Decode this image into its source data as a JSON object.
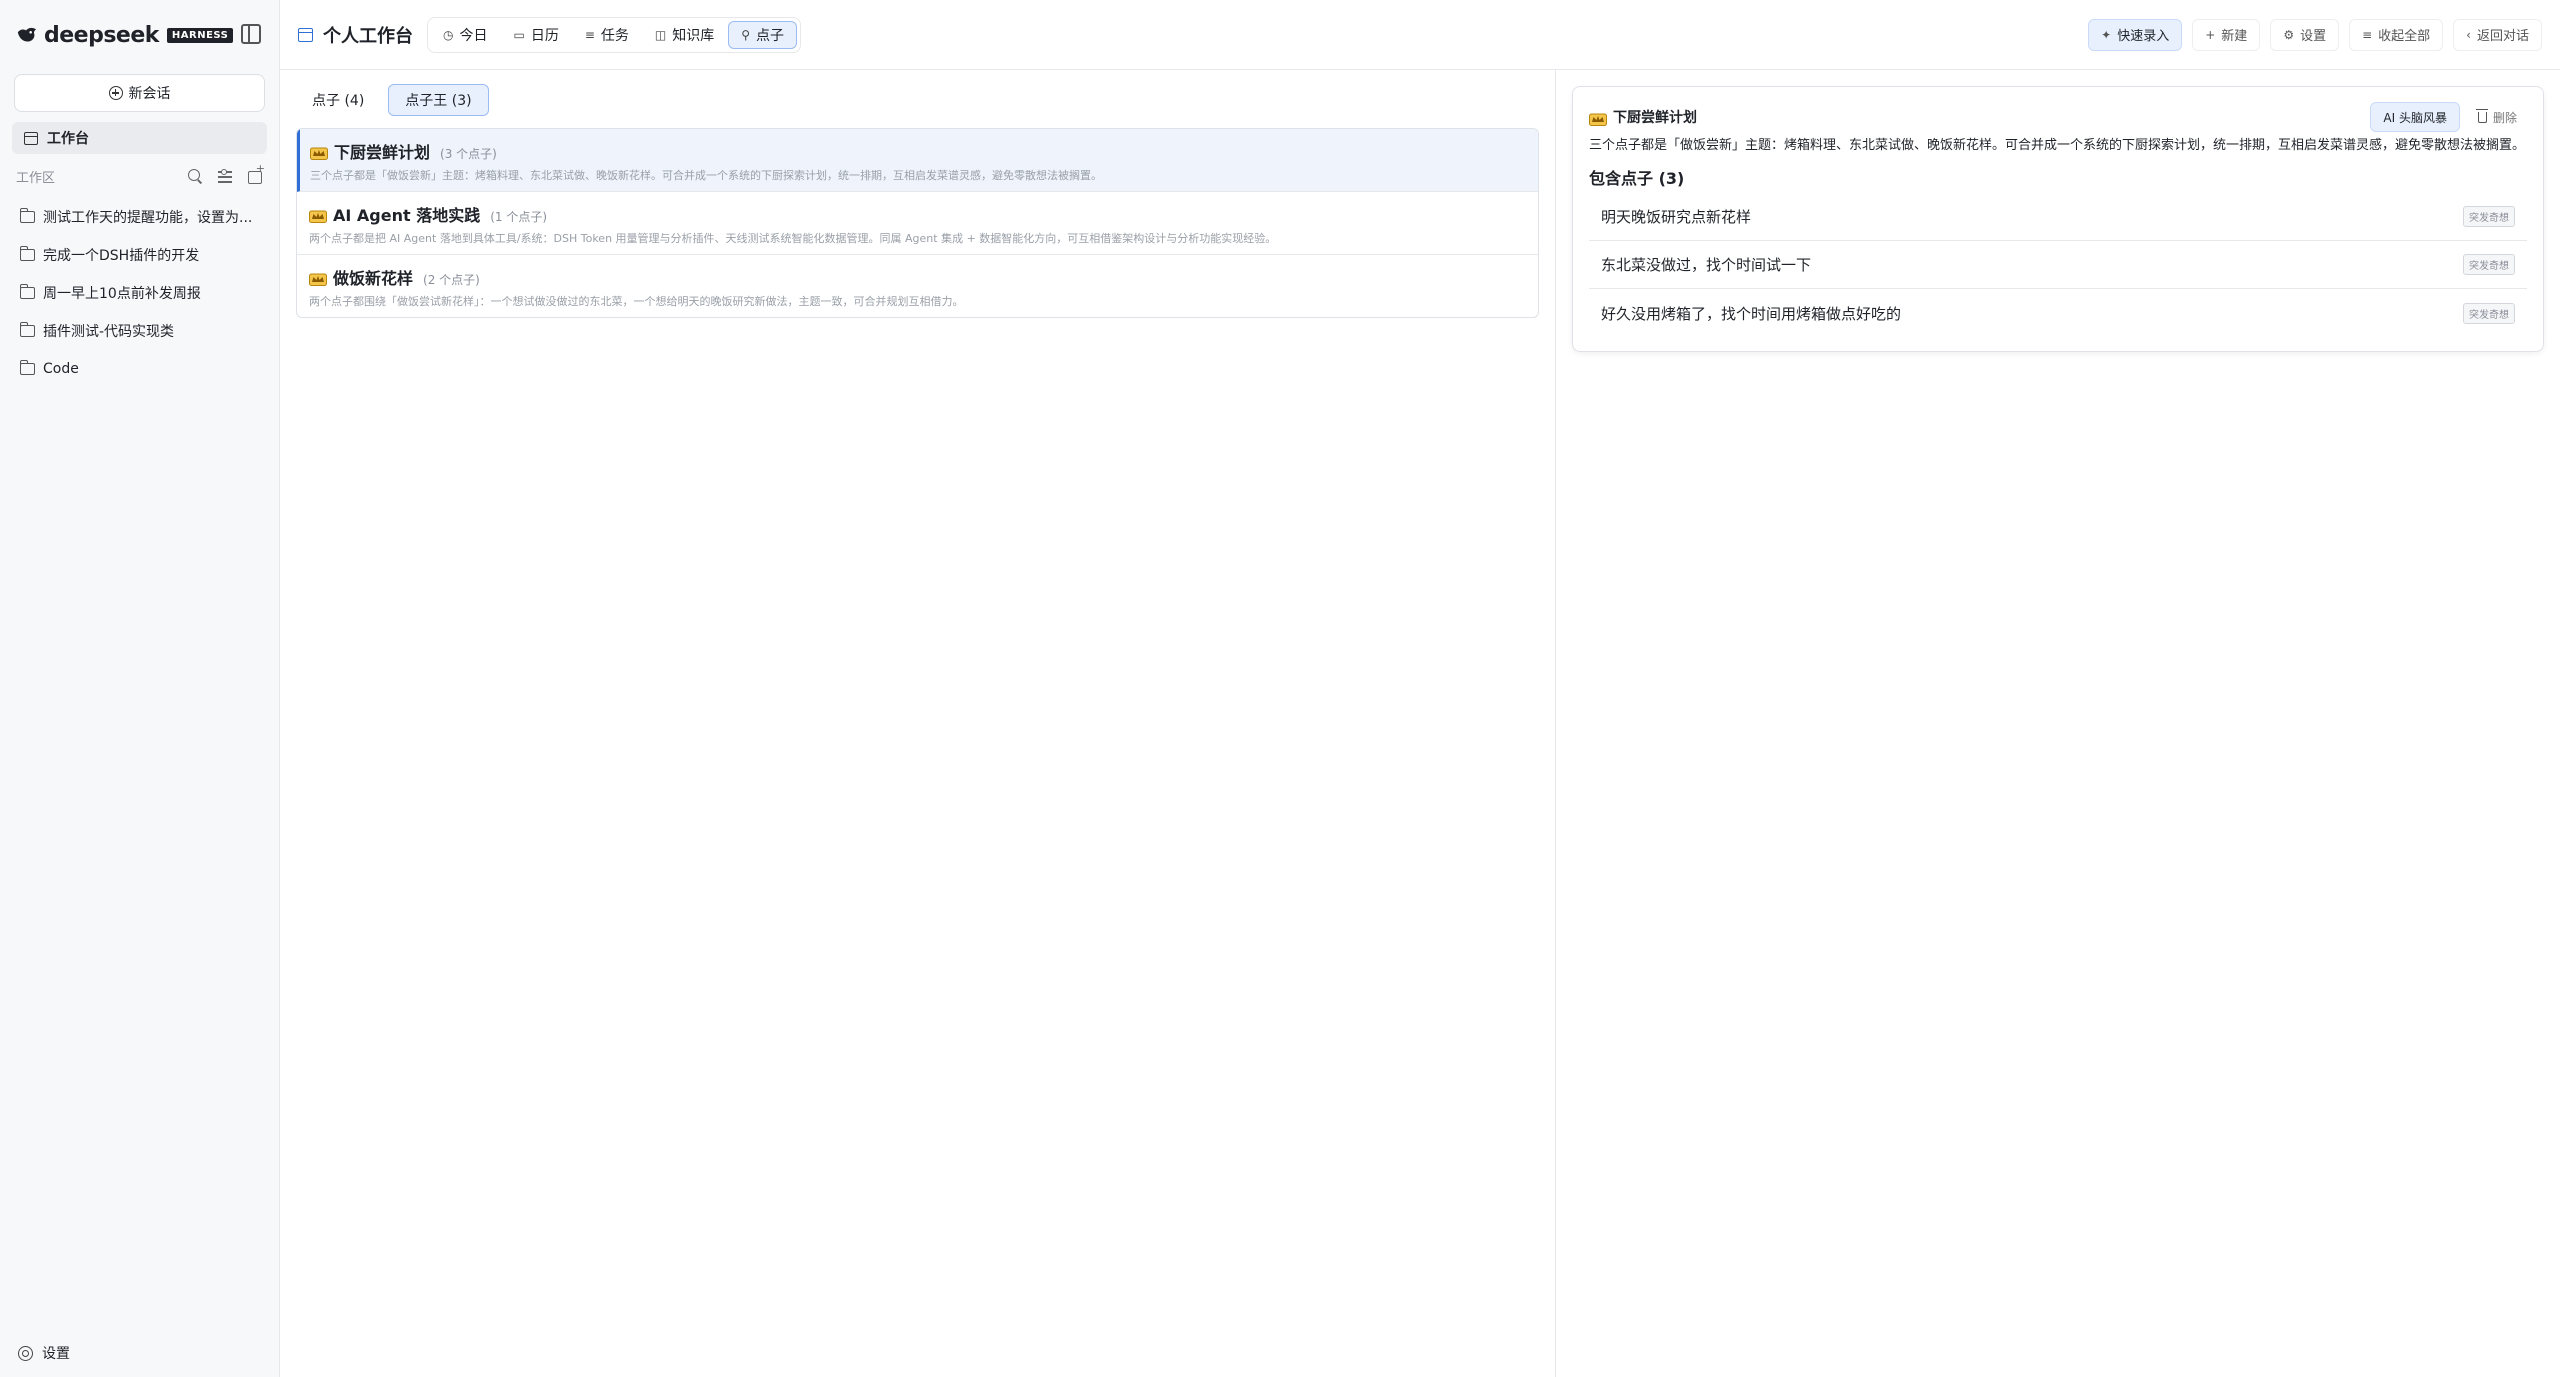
{
  "brand": {
    "name": "deepseek",
    "badge": "HARNESS"
  },
  "sidebar": {
    "new_chat": "新会话",
    "workbench": "工作台",
    "workspace_title": "工作区",
    "folders": [
      "测试工作天的提醒功能，设置为...",
      "完成一个DSH插件的开发",
      "周一早上10点前补发周报",
      "插件测试-代码实现类",
      "Code"
    ],
    "settings": "设置"
  },
  "topbar": {
    "title": "个人工作台",
    "tabs": [
      {
        "label": "今日",
        "icon": "clock-icon"
      },
      {
        "label": "日历",
        "icon": "calendar-icon"
      },
      {
        "label": "任务",
        "icon": "list-icon"
      },
      {
        "label": "知识库",
        "icon": "book-icon"
      },
      {
        "label": "点子",
        "icon": "pin-icon",
        "active": true
      }
    ],
    "actions": {
      "quick_entry": "快速录入",
      "new": "新建",
      "settings": "设置",
      "collapse_all": "收起全部",
      "back": "返回对话"
    }
  },
  "subtabs": [
    {
      "label": "点子 (4)"
    },
    {
      "label": "点子王 (3)",
      "active": true
    }
  ],
  "groups": [
    {
      "title": "下厨尝鲜计划",
      "count": "(3 个点子)",
      "desc": "三个点子都是「做饭尝新」主题：烤箱料理、东北菜试做、晚饭新花样。可合并成一个系统的下厨探索计划，统一排期，互相启发菜谱灵感，避免零散想法被搁置。"
    },
    {
      "title": "AI Agent 落地实践",
      "count": "(1 个点子)",
      "desc": "两个点子都是把 AI Agent 落地到具体工具/系统：DSH Token 用量管理与分析插件、天线测试系统智能化数据管理。同属 Agent 集成 + 数据智能化方向，可互相借鉴架构设计与分析功能实现经验。"
    },
    {
      "title": "做饭新花样",
      "count": "(2 个点子)",
      "desc": "两个点子都围绕「做饭尝试新花样」：一个想试做没做过的东北菜，一个想给明天的晚饭研究新做法，主题一致，可合并规划互相借力。"
    }
  ],
  "detail": {
    "title": "下厨尝鲜计划",
    "ai_button": "AI 头脑风暴",
    "delete": "删除",
    "desc": "三个点子都是「做饭尝新」主题：烤箱料理、东北菜试做、晚饭新花样。可合并成一个系统的下厨探索计划，统一排期，互相启发菜谱灵感，避免零散想法被搁置。",
    "sub_title": "包含点子 (3)",
    "ideas": [
      {
        "text": "明天晚饭研究点新花样",
        "tag": "突发奇想"
      },
      {
        "text": "东北菜没做过，找个时间试一下",
        "tag": "突发奇想"
      },
      {
        "text": "好久没用烤箱了，找个时间用烤箱做点好吃的",
        "tag": "突发奇想"
      }
    ]
  },
  "colors": {
    "accent": "#2f6fd6",
    "accent_bg": "#e8f0fd",
    "crown": "#d9a21b"
  }
}
